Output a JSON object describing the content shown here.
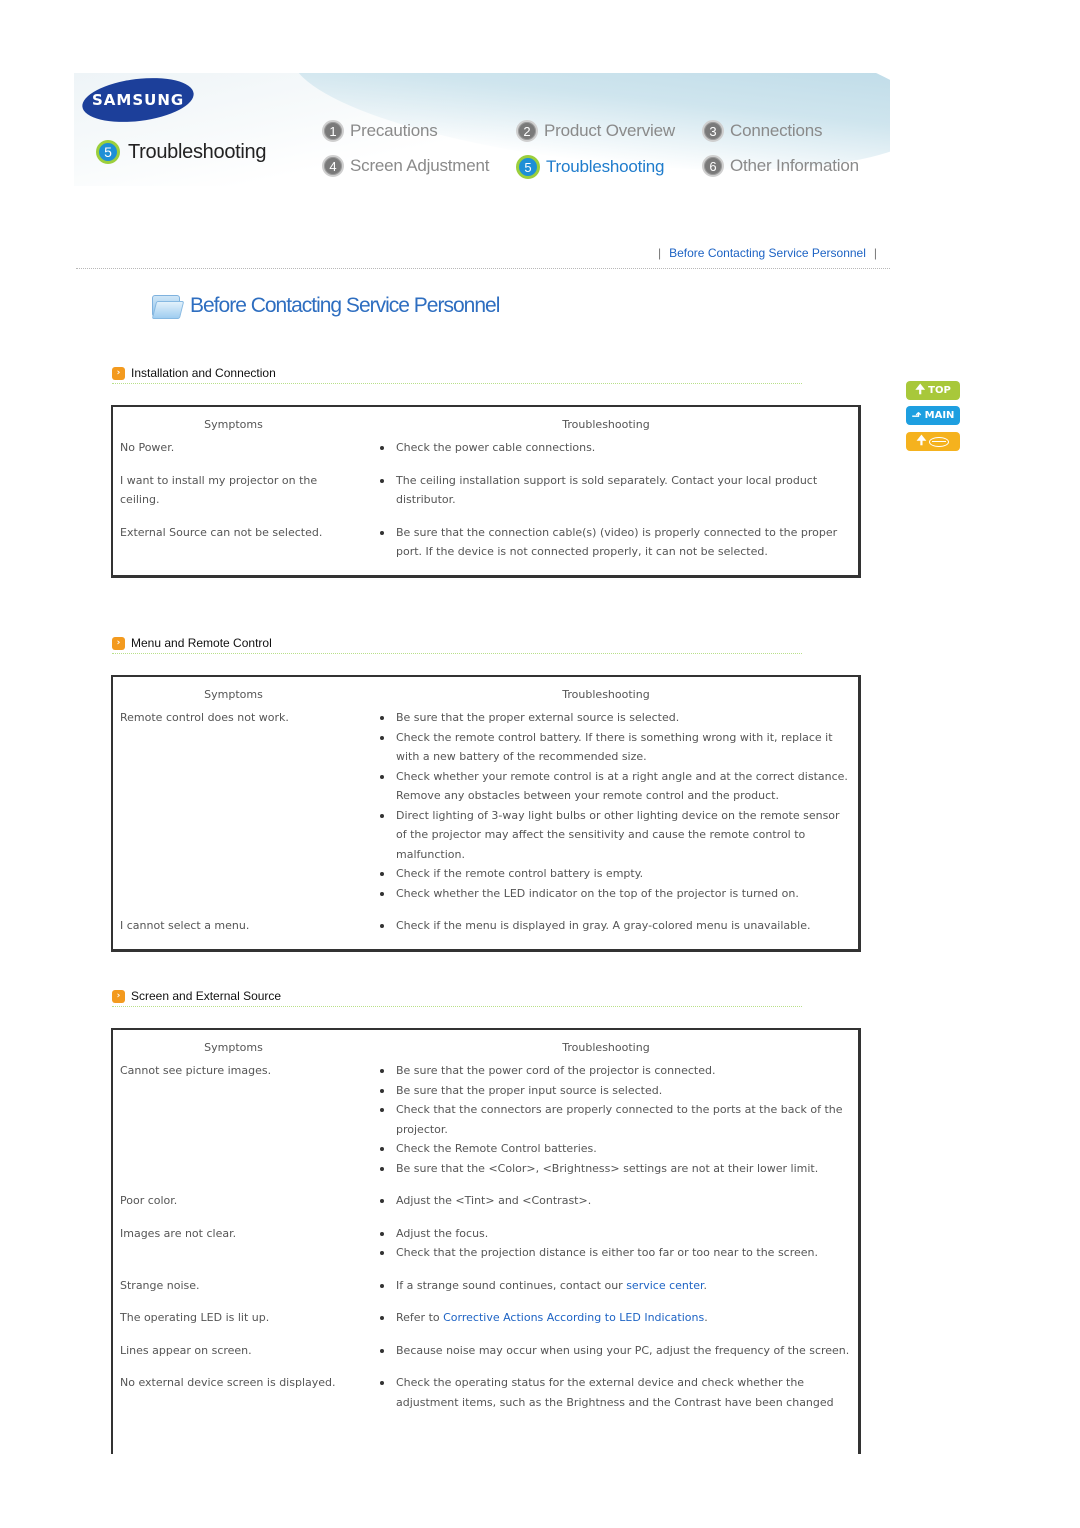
{
  "header": {
    "brand": "SAMSUNG",
    "current_section": {
      "number": "5",
      "label": "Troubleshooting"
    },
    "nav": [
      {
        "number": "1",
        "label": "Precautions",
        "active": false
      },
      {
        "number": "2",
        "label": "Product Overview",
        "active": false
      },
      {
        "number": "3",
        "label": "Connections",
        "active": false
      },
      {
        "number": "4",
        "label": "Screen Adjustment",
        "active": false
      },
      {
        "number": "5",
        "label": "Troubleshooting",
        "active": true
      },
      {
        "number": "6",
        "label": "Other Information",
        "active": false
      }
    ]
  },
  "breadcrumb": {
    "separator": "|",
    "link": "Before Contacting Service Personnel"
  },
  "page_title": "Before Contacting Service Personnel",
  "side_buttons": {
    "top": "TOP",
    "main": "MAIN",
    "back_icon": "lips-icon"
  },
  "columns": {
    "symptoms": "Symptoms",
    "troubleshooting": "Troubleshooting"
  },
  "colors": {
    "link": "#1d63c4",
    "accent_orange": "#f39a1e",
    "active_nav": "#1f7ccc"
  },
  "sections": [
    {
      "title": "Installation and Connection",
      "rows": [
        {
          "symptom": "No Power.",
          "fixes": [
            "Check the power cable connections."
          ]
        },
        {
          "symptom": "I want to install my projector on the ceiling.",
          "fixes": [
            "The ceiling installation support is sold separately. Contact your local product distributor."
          ]
        },
        {
          "symptom": "External Source can not be selected.",
          "fixes": [
            "Be sure that the connection cable(s) (video) is properly connected to the proper port. If the device is not connected properly, it can not be selected."
          ]
        }
      ]
    },
    {
      "title": "Menu and Remote Control",
      "rows": [
        {
          "symptom": "Remote control does not work.",
          "fixes": [
            "Be sure that the proper external source is selected.",
            "Check the remote control battery. If there is something wrong with it, replace it with a new battery of the recommended size.",
            "Check whether your remote control is at a right angle and at the correct distance. Remove any obstacles between your remote control and the product.",
            "Direct lighting of 3-way light bulbs or other lighting device on the remote sensor of the projector may affect the sensitivity and cause the remote control to malfunction.",
            "Check if the remote control battery is empty.",
            "Check whether the LED indicator on the top of the projector is turned on."
          ]
        },
        {
          "symptom": "I cannot select a menu.",
          "fixes": [
            "Check if the menu is displayed in gray. A gray-colored menu is unavailable."
          ]
        }
      ]
    },
    {
      "title": "Screen and External Source",
      "rows": [
        {
          "symptom": "Cannot see picture images.",
          "fixes": [
            "Be sure that the power cord of the projector is connected.",
            "Be sure that the proper input source is selected.",
            "Check that the connectors are properly connected to the ports at the back of the projector.",
            "Check the Remote Control batteries.",
            "Be sure that the <Color>, <Brightness> settings are not at their lower limit."
          ]
        },
        {
          "symptom": "Poor color.",
          "fixes": [
            "Adjust the <Tint> and <Contrast>."
          ]
        },
        {
          "symptom": "Images are not clear.",
          "fixes": [
            "Adjust the focus.",
            "Check that the projection distance is either too far or too near to the screen."
          ]
        },
        {
          "symptom": "Strange noise.",
          "fixes": [
            {
              "before": "If a strange sound continues, contact our ",
              "link": "service center",
              "after": "."
            }
          ]
        },
        {
          "symptom": "The operating LED is lit up.",
          "fixes": [
            {
              "before": "Refer to ",
              "link": "Corrective Actions According to LED Indications",
              "after": "."
            }
          ]
        },
        {
          "symptom": "Lines appear on screen.",
          "fixes": [
            "Because noise may occur when using your PC, adjust the frequency of the screen."
          ]
        },
        {
          "symptom": "No external device screen is displayed.",
          "fixes": [
            "Check the operating status for the external device and check whether the adjustment items, such as the Brightness and the Contrast have been changed"
          ]
        }
      ]
    }
  ]
}
